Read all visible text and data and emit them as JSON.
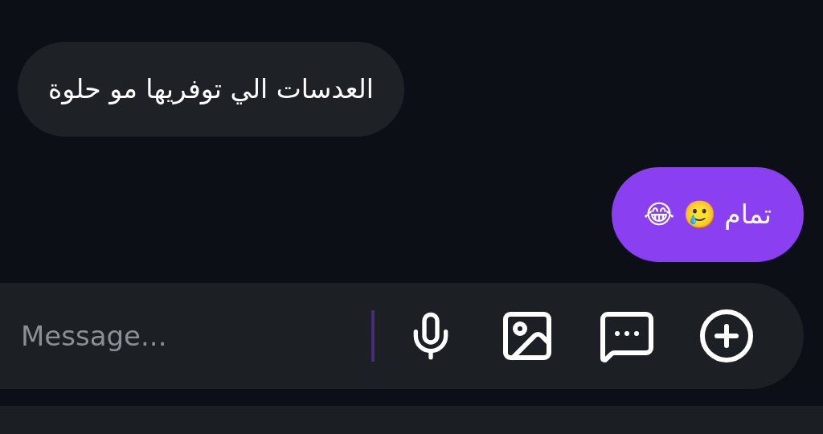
{
  "messages": [
    {
      "kind": "incoming",
      "text": "العدسات الي توفريها مو حلوة"
    },
    {
      "kind": "outgoing",
      "text": "تمام 🥲 😂"
    }
  ],
  "composer": {
    "placeholder": "Message..."
  }
}
